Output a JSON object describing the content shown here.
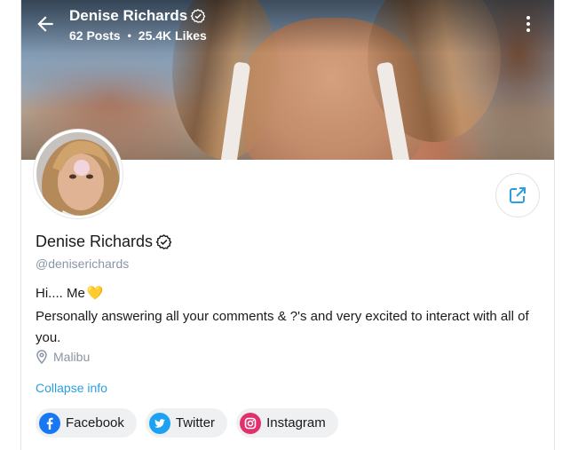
{
  "header": {
    "name": "Denise Richards",
    "posts": "62 Posts",
    "likes": "25.4K Likes"
  },
  "profile": {
    "name": "Denise Richards",
    "handle": "@deniserichards",
    "bio_line1": "Hi.... Me",
    "bio_emoji": "💛",
    "bio_line2": "Personally answering all your comments & ?'s and very excited to interact with all of you.",
    "location": "Malibu",
    "collapse_label": "Collapse info"
  },
  "socials": [
    {
      "label": "Facebook",
      "icon": "facebook-icon",
      "color": "#1877f2"
    },
    {
      "label": "Twitter",
      "icon": "twitter-icon",
      "color": "#1da1f2"
    },
    {
      "label": "Instagram",
      "icon": "instagram-icon",
      "color": "#e1306c"
    }
  ],
  "icons": {
    "back": "arrow-left-icon",
    "verified": "verified-badge-icon",
    "menu": "more-vertical-icon",
    "share": "share-icon",
    "location": "location-pin-icon"
  },
  "colors": {
    "accent": "#2b9ee0",
    "muted": "#8a96a3",
    "chip_bg": "#eef0f2"
  }
}
